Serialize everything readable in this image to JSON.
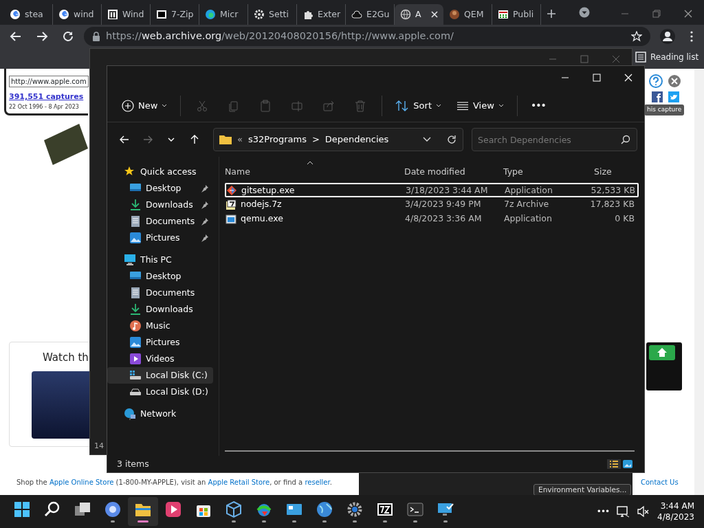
{
  "browser": {
    "tabs": [
      {
        "label": "stea",
        "selected": false
      },
      {
        "label": "wind",
        "selected": false
      },
      {
        "label": "Wind",
        "selected": false
      },
      {
        "label": "7-Zip",
        "selected": false
      },
      {
        "label": "Micr",
        "selected": false
      },
      {
        "label": "Setti",
        "selected": false
      },
      {
        "label": "Exter",
        "selected": false
      },
      {
        "label": "E2Gu",
        "selected": false
      },
      {
        "label": "A",
        "selected": true
      },
      {
        "label": "QEM",
        "selected": false
      },
      {
        "label": "Publi",
        "selected": false
      }
    ],
    "address": {
      "scheme": "https://",
      "host": "web.archive.org",
      "path": "/web/20120408020156/http://www.apple.com/"
    },
    "reading_list": "Reading list"
  },
  "webpage": {
    "url_value": "http://www.apple.com",
    "captures": "391,551 captures",
    "date_range": "22 Oct 1996 - 8 Apr 2023",
    "capture_label": "his capture",
    "promo_heading": "Watch th",
    "page_number": "14",
    "footer": [
      {
        "text": "Shop the ",
        "link": false
      },
      {
        "text": "Apple Online Store",
        "link": true
      },
      {
        "text": " (1-800-MY-APPLE), visit an ",
        "link": false
      },
      {
        "text": "Apple Retail Store",
        "link": true
      },
      {
        "text": ", or find a ",
        "link": false
      },
      {
        "text": "reseller",
        "link": true
      },
      {
        "text": ".",
        "link": false
      }
    ],
    "contact": "Contact Us"
  },
  "background_dialog": {
    "button": "Environment Variables..."
  },
  "explorer": {
    "toolbar": [
      {
        "kind": "menu",
        "label": "New",
        "disabled": false
      },
      {
        "kind": "icon",
        "disabled": true
      },
      {
        "kind": "icon",
        "disabled": true
      },
      {
        "kind": "icon",
        "disabled": true
      },
      {
        "kind": "icon",
        "disabled": true
      },
      {
        "kind": "icon",
        "disabled": true
      },
      {
        "kind": "icon",
        "disabled": true
      },
      {
        "kind": "menu",
        "label": "Sort",
        "disabled": false
      },
      {
        "kind": "menu",
        "label": "View",
        "disabled": false
      },
      {
        "kind": "more",
        "label": "•••",
        "disabled": false
      }
    ],
    "nav": [
      {
        "disabled": false
      },
      {
        "disabled": true
      },
      {
        "disabled": false
      },
      {
        "disabled": false
      }
    ],
    "breadcrumb": {
      "overflow": "«",
      "segments": [
        "s32Programs",
        "Dependencies"
      ],
      "separator": ">"
    },
    "search": {
      "placeholder": "Search Dependencies"
    },
    "sidebar": [
      {
        "label": "Quick access",
        "pinned": false,
        "selected": false,
        "children": [
          {
            "label": "Desktop",
            "pinned": true,
            "selected": false
          },
          {
            "label": "Downloads",
            "pinned": true,
            "selected": false
          },
          {
            "label": "Documents",
            "pinned": true,
            "selected": false
          },
          {
            "label": "Pictures",
            "pinned": true,
            "selected": false
          }
        ]
      },
      {
        "label": "This PC",
        "pinned": false,
        "selected": false,
        "children": [
          {
            "label": "Desktop",
            "pinned": false,
            "selected": false
          },
          {
            "label": "Documents",
            "pinned": false,
            "selected": false
          },
          {
            "label": "Downloads",
            "pinned": false,
            "selected": false
          },
          {
            "label": "Music",
            "pinned": false,
            "selected": false
          },
          {
            "label": "Pictures",
            "pinned": false,
            "selected": false
          },
          {
            "label": "Videos",
            "pinned": false,
            "selected": false
          },
          {
            "label": "Local Disk (C:)",
            "pinned": false,
            "selected": true
          },
          {
            "label": "Local Disk (D:)",
            "pinned": false,
            "selected": false
          }
        ]
      },
      {
        "label": "Network",
        "pinned": false,
        "selected": false
      }
    ],
    "columns": [
      "Name",
      "Date modified",
      "Type",
      "Size"
    ],
    "files": [
      {
        "name": "gitsetup.exe",
        "date": "3/18/2023 3:44 AM",
        "type": "Application",
        "size": "52,533 KB",
        "selected": true
      },
      {
        "name": "nodejs.7z",
        "date": "3/4/2023 9:49 PM",
        "type": "7z Archive",
        "size": "17,823 KB",
        "selected": false
      },
      {
        "name": "qemu.exe",
        "date": "4/8/2023 3:36 AM",
        "type": "Application",
        "size": "0 KB",
        "selected": false
      }
    ],
    "status": "3 items"
  },
  "taskbar": {
    "apps": [
      {
        "running": false,
        "active": false
      },
      {
        "running": false,
        "active": false
      },
      {
        "running": false,
        "active": false
      },
      {
        "running": true,
        "active": false
      },
      {
        "running": true,
        "active": true
      },
      {
        "running": false,
        "active": false
      },
      {
        "running": false,
        "active": false
      },
      {
        "running": true,
        "active": false
      },
      {
        "running": true,
        "active": false
      },
      {
        "running": true,
        "active": false
      },
      {
        "running": true,
        "active": false
      },
      {
        "running": true,
        "active": false
      },
      {
        "running": true,
        "active": false
      },
      {
        "running": true,
        "active": false
      },
      {
        "running": true,
        "active": false
      }
    ],
    "overflow": "•••",
    "time": "3:44 AM",
    "date": "4/8/2023"
  }
}
